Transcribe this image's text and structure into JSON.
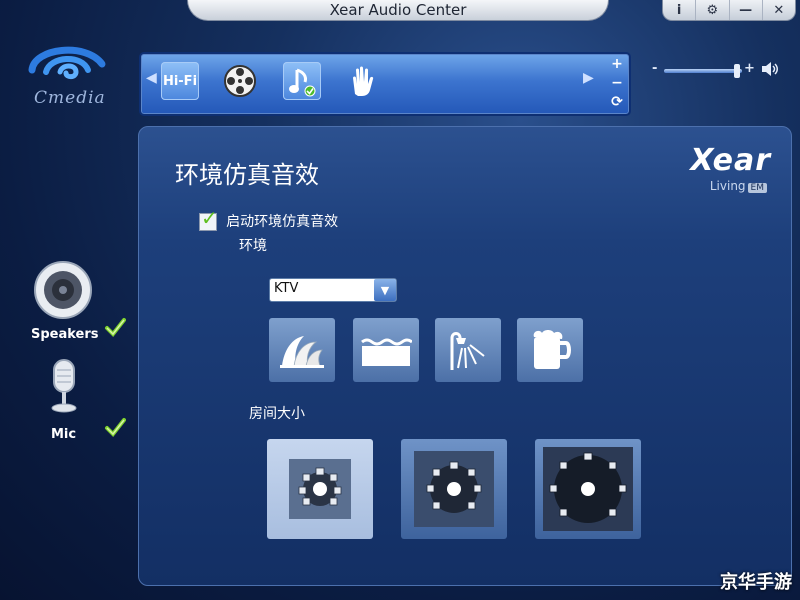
{
  "window": {
    "title": "Xear Audio Center"
  },
  "logo": {
    "text": "Cmedia"
  },
  "toolbar": {
    "hifi_label": "Hi-Fi"
  },
  "sidebar": {
    "devices": [
      {
        "label": "Speakers",
        "checked": true
      },
      {
        "label": "Mic",
        "checked": true
      }
    ]
  },
  "panel": {
    "title": "环境仿真音效",
    "brand": "Xear",
    "brand_sub": "Living",
    "brand_badge": "EM",
    "enable_label": "启动环境仿真音效",
    "environment_label": "环境",
    "environment_value": "KTV",
    "room_size_label": "房间大小"
  },
  "watermark": "京华手游",
  "colors": {
    "accent": "#3c74cf",
    "panel": "#1d3f7b",
    "check": "#5fbf1f"
  }
}
